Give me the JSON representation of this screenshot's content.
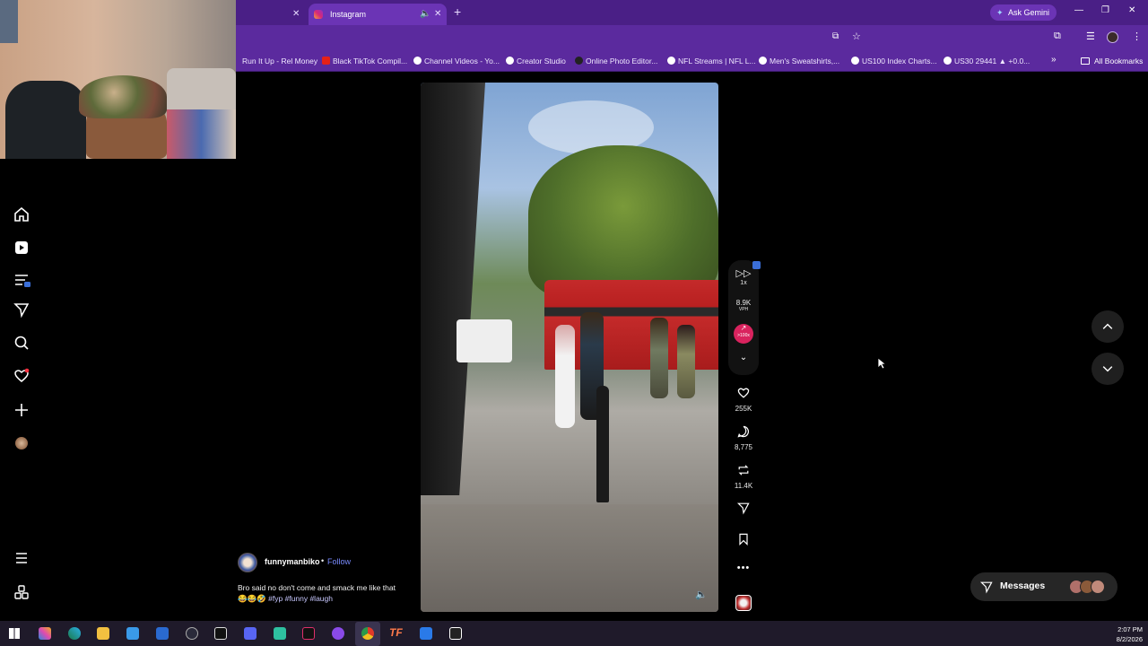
{
  "browser": {
    "tabs": [
      {
        "title": ""
      },
      {
        "title": "Instagram"
      }
    ],
    "ask_gemini": "Ask Gemini",
    "bookmarks": [
      "Run It Up - Rel Money",
      "Black TikTok Compil...",
      "Channel Videos - Yo...",
      "Creator Studio",
      "Online Photo Editor...",
      "NFL Streams | NFL L...",
      "Men's Sweatshirts,...",
      "US100 Index Charts...",
      "US30 29441 ▲ +0.0..."
    ],
    "all_bookmarks": "All Bookmarks"
  },
  "post": {
    "username": "funnymanbiko",
    "follow": "Follow",
    "caption": "Bro said no don't come and smack me like that 😂😂🤣",
    "hashtags": "#fyp #funny #laugh"
  },
  "rail": {
    "speed": "1x",
    "vph": "8.9K",
    "vph_label": "VPH",
    "trend": ">100x",
    "likes": "255K",
    "comments": "8,775",
    "reposts": "11.4K"
  },
  "messages": {
    "label": "Messages"
  },
  "clock": {
    "time": "2:07 PM",
    "date": "8/2/2026"
  },
  "colors": {
    "tabstrip": "#4a1f86",
    "toolbar": "#5b2a9e",
    "accent_follow": "#7a8cff",
    "trend_badge": "#d9235e"
  }
}
